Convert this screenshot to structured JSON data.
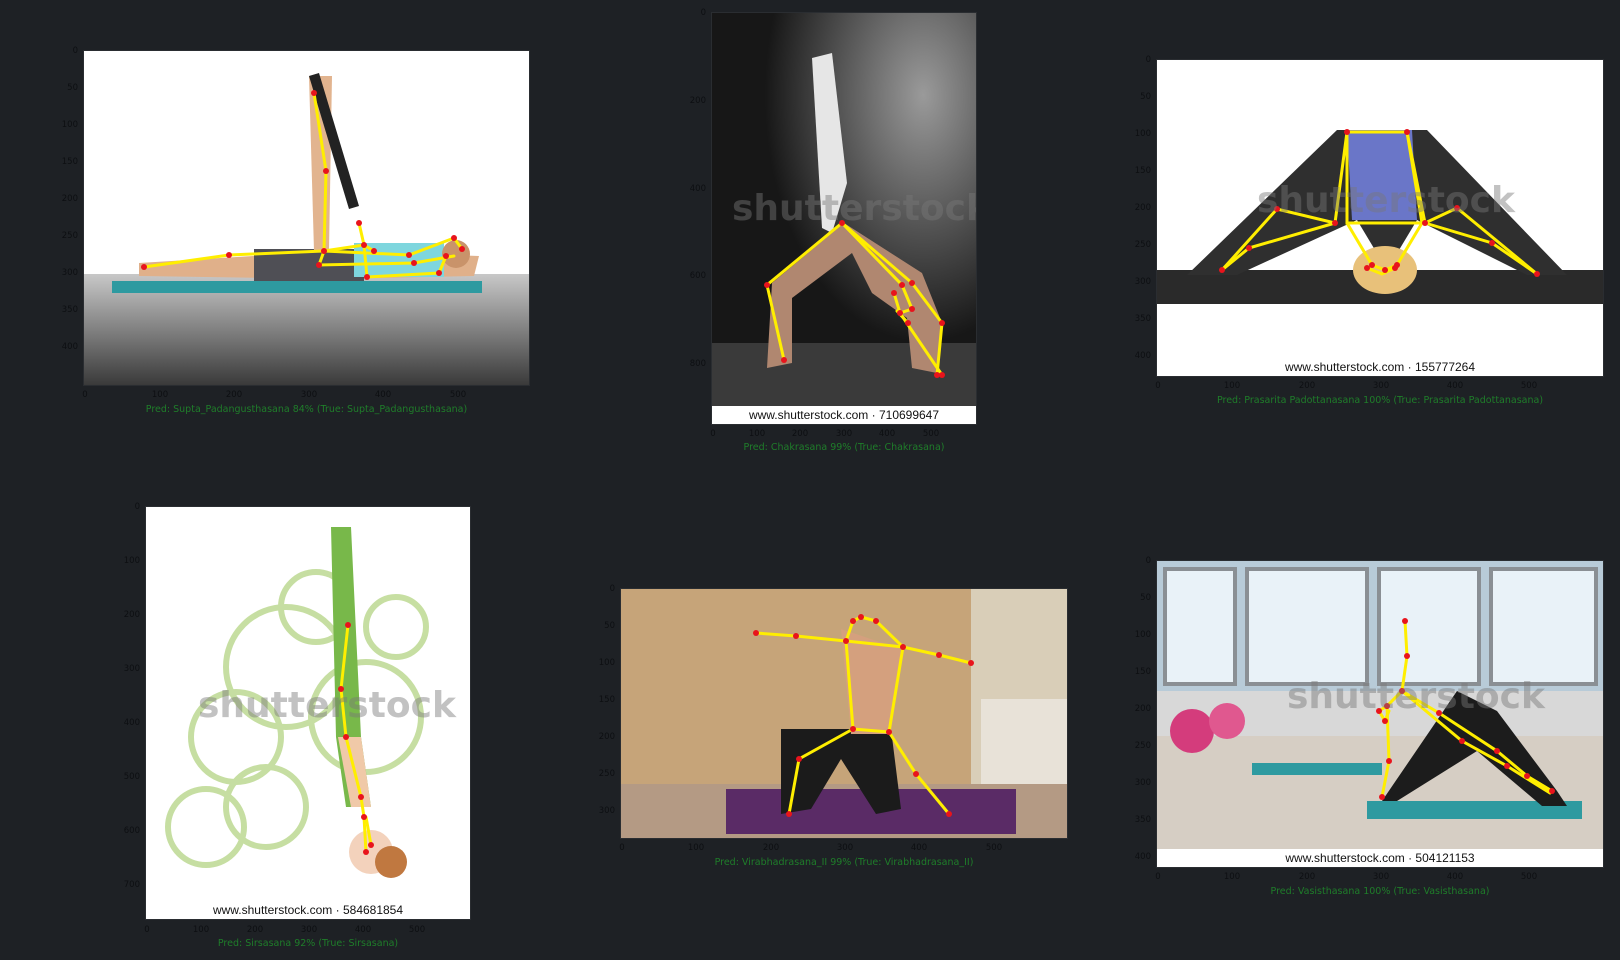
{
  "panels": [
    {
      "id": "p1",
      "caption": "Pred: Supta_Padangusthasana 84% (True: Supta_Padangusthasana)",
      "yticks": [
        "0",
        "50",
        "100",
        "150",
        "200",
        "250",
        "300",
        "350",
        "400"
      ],
      "xticks": [
        "0",
        "100",
        "200",
        "300",
        "400",
        "500"
      ],
      "watermark": "",
      "url": ""
    },
    {
      "id": "p2",
      "caption": "Pred: Chakrasana 99% (True: Chakrasana)",
      "yticks": [
        "0",
        "200",
        "400",
        "600",
        "800"
      ],
      "xticks": [
        "0",
        "100",
        "200",
        "300",
        "400",
        "500"
      ],
      "watermark": "shutterstock",
      "url": "www.shutterstock.com · 710699647"
    },
    {
      "id": "p3",
      "caption": "Pred: Prasarita Padottanasana 100% (True: Prasarita Padottanasana)",
      "yticks": [
        "0",
        "50",
        "100",
        "150",
        "200",
        "250",
        "300",
        "350",
        "400"
      ],
      "xticks": [
        "0",
        "100",
        "200",
        "300",
        "400",
        "500"
      ],
      "watermark": "shutterstock",
      "url": "www.shutterstock.com · 155777264"
    },
    {
      "id": "p4",
      "caption": "Pred: Sirsasana 92% (True: Sirsasana)",
      "yticks": [
        "0",
        "100",
        "200",
        "300",
        "400",
        "500",
        "600",
        "700"
      ],
      "xticks": [
        "0",
        "100",
        "200",
        "300",
        "400",
        "500"
      ],
      "watermark": "shutterstock",
      "url": "www.shutterstock.com · 584681854"
    },
    {
      "id": "p5",
      "caption": "Pred: Virabhadrasana_II 99% (True: Virabhadrasana_II)",
      "yticks": [
        "0",
        "50",
        "100",
        "150",
        "200",
        "250",
        "300"
      ],
      "xticks": [
        "0",
        "100",
        "200",
        "300",
        "400",
        "500"
      ],
      "watermark": "",
      "url": ""
    },
    {
      "id": "p6",
      "caption": "Pred: Vasisthasana 100% (True: Vasisthasana)",
      "yticks": [
        "0",
        "50",
        "100",
        "150",
        "200",
        "250",
        "300",
        "350",
        "400"
      ],
      "xticks": [
        "0",
        "100",
        "200",
        "300",
        "400",
        "500"
      ],
      "watermark": "shutterstock",
      "url": "www.shutterstock.com · 504121153"
    }
  ],
  "colors": {
    "background": "#1e2125",
    "skeleton": "#ffee00",
    "keypoint": "#e8141c",
    "caption": "#1f7d2a"
  }
}
